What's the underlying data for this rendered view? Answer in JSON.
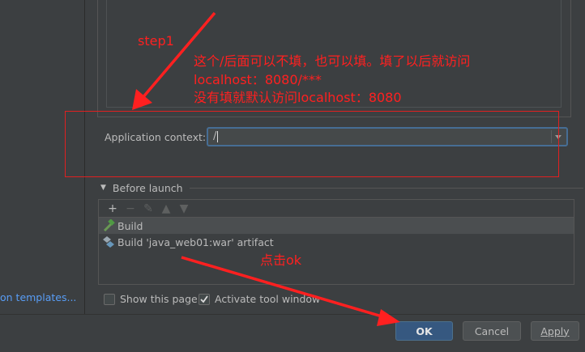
{
  "sidebar": {
    "templates_link": "on templates..."
  },
  "context": {
    "label": "Application context:",
    "value": "/"
  },
  "before_launch": {
    "title": "Before launch",
    "tasks": [
      {
        "label": "Build",
        "icon": "hammer-icon"
      },
      {
        "label": "Build 'java_web01:war' artifact",
        "icon": "artifact-icon"
      }
    ]
  },
  "options": {
    "show_page": "Show this page",
    "activate_tool_window": "Activate tool window",
    "show_page_checked": false,
    "activate_checked": true
  },
  "buttons": {
    "ok": "OK",
    "cancel": "Cancel",
    "apply": "Apply"
  },
  "annotations": {
    "step1": "step1",
    "note_line1": "这个/后面可以不填，也可以填。填了以后就访问",
    "note_line2": "localhost：8080/***",
    "note_line3": "没有填就默认访问localhost：8080",
    "click_ok": "点击ok",
    "color": "#ff2020"
  }
}
